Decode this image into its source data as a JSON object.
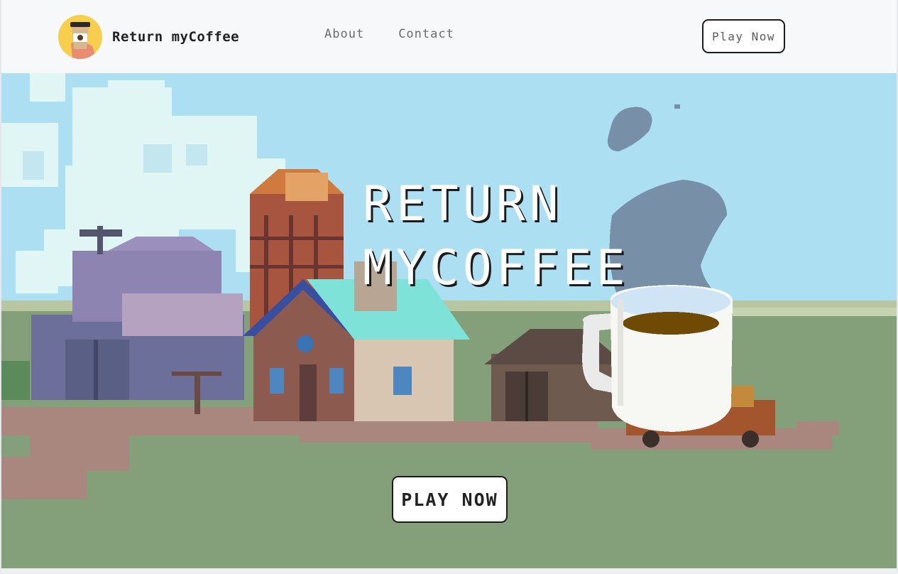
{
  "header": {
    "brand_name": "Return myCoffee",
    "logo_icon": "coffee-cup-logo-icon",
    "nav": [
      {
        "label": "About"
      },
      {
        "label": "Contact"
      }
    ],
    "cta_label": "Play Now"
  },
  "hero": {
    "title": "RETURN\nMYCOFFEE",
    "cta_label": "PLAY NOW",
    "background": "pixel-art-farm-scene"
  },
  "colors": {
    "sky": "#abdff1",
    "grass": "#83a07b",
    "logo_bg": "#f7cf4d",
    "button_border": "#1b1b1b"
  }
}
